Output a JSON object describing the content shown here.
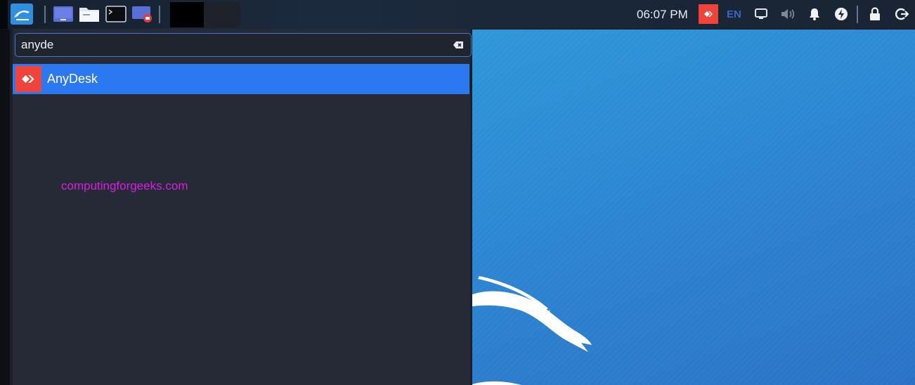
{
  "panel": {
    "clock": "06:07 PM",
    "language": "EN",
    "launchers": [
      {
        "name": "kali-menu",
        "icon": "kali-dragon-icon"
      },
      {
        "name": "show-desktop",
        "icon": "desktop-icon"
      },
      {
        "name": "file-manager",
        "icon": "folder-icon"
      },
      {
        "name": "terminal",
        "icon": "terminal-icon"
      },
      {
        "name": "screen-recorder",
        "icon": "screen-record-icon"
      }
    ],
    "tray": [
      "anydesk-tray-icon",
      "display-icon",
      "volume-icon",
      "bell-icon",
      "power-icon",
      "lock-icon",
      "logout-icon"
    ]
  },
  "launcher": {
    "search": {
      "value": "anyde"
    },
    "results": [
      {
        "label": "AnyDesk",
        "icon": "anydesk-icon",
        "selected": true
      }
    ]
  },
  "watermark": "computingforgeeks.com",
  "colors": {
    "selection": "#2b78f0",
    "anydesk_red": "#ef443b",
    "watermark": "#d81fe0",
    "panel_bg": "#1b2a3d",
    "desktop_blue": "#2d86d2"
  }
}
